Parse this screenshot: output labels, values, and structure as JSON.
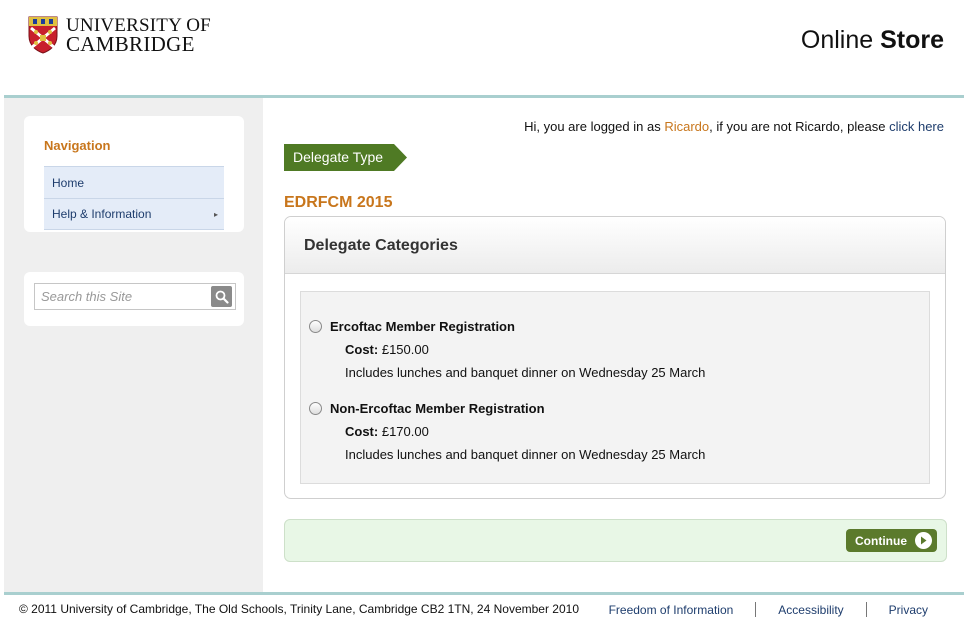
{
  "header": {
    "university_line1": "UNIVERSITY OF",
    "university_line2": "CAMBRIDGE",
    "store_title_prefix": "Online",
    "store_title_bold": "Store"
  },
  "sidebar": {
    "nav_title": "Navigation",
    "items": [
      {
        "label": "Home",
        "has_submenu": false
      },
      {
        "label": "Help & Information",
        "has_submenu": true
      }
    ],
    "search": {
      "placeholder": "Search this Site",
      "value": ""
    }
  },
  "main": {
    "login": {
      "prefix": "Hi, you are logged in as",
      "user": "Ricardo",
      "middle": ", if you are not Ricardo, please",
      "link": "click here"
    },
    "step_label": "Delegate Type",
    "event_title": "EDRFCM 2015",
    "categories_title": "Delegate Categories",
    "options": [
      {
        "name": "Ercoftac Member Registration",
        "cost_label": "Cost:",
        "cost": "£150.00",
        "description": "Includes lunches and banquet dinner on Wednesday 25 March",
        "selected": false
      },
      {
        "name": "Non-Ercoftac Member Registration",
        "cost_label": "Cost:",
        "cost": "£170.00",
        "description": "Includes lunches and banquet dinner on Wednesday 25 March",
        "selected": false
      }
    ],
    "continue_label": "Continue"
  },
  "footer": {
    "copyright": "© 2011 University of Cambridge, The Old Schools, Trinity Lane, Cambridge CB2 1TN, 24 November 2010",
    "links": [
      "Freedom of Information",
      "Accessibility",
      "Privacy"
    ]
  },
  "colors": {
    "accent_orange": "#c8761c",
    "link_blue": "#1e3d6d",
    "step_green": "#4f7a24",
    "rule_teal": "#a9cfcf"
  }
}
